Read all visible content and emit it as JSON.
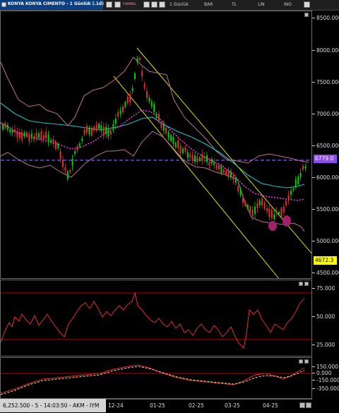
{
  "window": {
    "title": "KONYA KONYA CIMENTO - 1 Günlük (.1d)",
    "toolbar": [
      {
        "label": "1 Günlük"
      },
      {
        "label": "BAR"
      },
      {
        "label": "TL"
      },
      {
        "label": "LIN"
      },
      {
        "label": "INO"
      }
    ],
    "formula_label": "FORMÜL"
  },
  "price_pane": {
    "y_axis": [
      "8500.000",
      "8000.000",
      "7500.000",
      "7000.000",
      "6500.000",
      "6000.000",
      "5500.000",
      "5000.000",
      "4500.000"
    ],
    "current_price_tag": "6779.0",
    "low_tag": "4672.3",
    "colors": {
      "candle_up": "#00d000",
      "candle_down": "#e03030",
      "bollinger": "#c07090",
      "sma": "#20c0c0",
      "dotted_ma": "#ff40ff",
      "channel": "#e0e000",
      "hline": "#7040ff",
      "marker": "#a0206a"
    }
  },
  "rsi_pane": {
    "y_axis": [
      "75.000",
      "50.000",
      "25.000"
    ],
    "levels": [
      70,
      30
    ]
  },
  "macd_pane": {
    "y_axis": [
      "150.000",
      "0.000",
      "-150.000",
      "-350.000"
    ]
  },
  "x_axis": {
    "labels": [
      "12-24",
      "01-25",
      "02-25",
      "03-25",
      "04-25"
    ]
  },
  "status_bar": {
    "text": "6,252.500 - 5 - 14:03:50 - AKM - IYM"
  }
}
